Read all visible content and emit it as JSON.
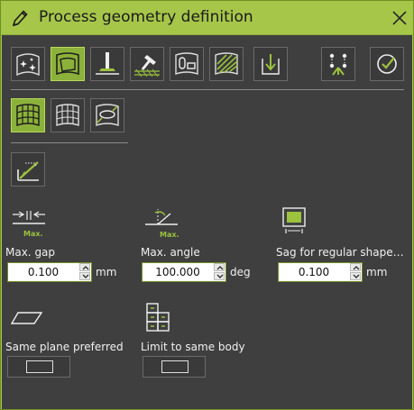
{
  "window": {
    "title": "Process geometry definition",
    "close_icon": "close-icon",
    "title_icon": "pencil-icon"
  },
  "toolbar1": {
    "buttons": [
      {
        "icon": "sparkle-surface-icon",
        "active": false
      },
      {
        "icon": "surface-outline-icon",
        "active": true
      },
      {
        "icon": "pin-plane-icon",
        "active": false
      },
      {
        "icon": "hammer-hatch-icon",
        "active": false
      },
      {
        "icon": "parts-shape-icon",
        "active": false
      },
      {
        "icon": "hatched-surface-icon",
        "active": false
      },
      {
        "icon": "import-arrow-icon",
        "active": false
      },
      {
        "icon": "network-nodes-icon",
        "active": false
      },
      {
        "icon": "check-circle-icon",
        "active": false
      }
    ]
  },
  "toolbar2": {
    "buttons": [
      {
        "icon": "mesh-grid-icon",
        "active": true
      },
      {
        "icon": "mesh-wire-icon",
        "active": false
      },
      {
        "icon": "mesh-ellipse-icon",
        "active": false
      }
    ]
  },
  "tool3": {
    "icon": "edge-weld-icon"
  },
  "params": {
    "max_gap": {
      "label": "Max. gap",
      "value": "0.100",
      "unit": "mm",
      "icon_text": "Max."
    },
    "max_angle": {
      "label": "Max. angle",
      "value": "100.000",
      "unit": "deg",
      "icon_text": "Max."
    },
    "sag": {
      "label": "Sag for regular shape…",
      "value": "0.100",
      "unit": "mm"
    },
    "same_plane": {
      "label": "Same plane preferred"
    },
    "same_body": {
      "label": "Limit to same body"
    }
  },
  "colors": {
    "accent": "#8cb13a",
    "panel": "#3f3f3f",
    "titlebar": "#a6c64a"
  }
}
